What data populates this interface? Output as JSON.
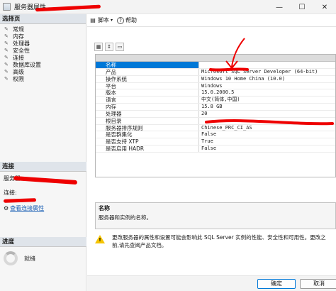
{
  "window": {
    "title": "服务器属性 -",
    "minimize": "—",
    "maximize": "☐",
    "close": "✕"
  },
  "left_panel": {
    "select_page_header": "选择页",
    "pages": [
      "常规",
      "内存",
      "处理器",
      "安全性",
      "连接",
      "数据库设置",
      "高级",
      "权限"
    ],
    "connection_header": "连接",
    "server_label": "服务器:",
    "connection_label": "连接:",
    "view_connection_link": "查看连接属性",
    "progress_header": "进度",
    "progress_status": "就绪"
  },
  "toolbar": {
    "script_label": "脚本",
    "help_label": "帮助"
  },
  "properties": {
    "rows": [
      {
        "name": "名称",
        "value": ""
      },
      {
        "name": "产品",
        "value": "Microsoft SQL Server Developer (64-bit)"
      },
      {
        "name": "操作系统",
        "value": "Windows 10 Home China (10.0)"
      },
      {
        "name": "平台",
        "value": "Windows"
      },
      {
        "name": "版本",
        "value": "15.0.2000.5"
      },
      {
        "name": "语言",
        "value": "中文(简体,中国)"
      },
      {
        "name": "内存",
        "value": "15.8 GB"
      },
      {
        "name": "处理器",
        "value": "20"
      },
      {
        "name": "根目录",
        "value": ""
      },
      {
        "name": "服务器排序规则",
        "value": "Chinese_PRC_CI_AS"
      },
      {
        "name": "是否群集化",
        "value": "False"
      },
      {
        "name": "是否支持 XTP",
        "value": "True"
      },
      {
        "name": "是否启用 HADR",
        "value": "False"
      }
    ]
  },
  "description": {
    "title": "名称",
    "text": "服务器和实例的名称。"
  },
  "warning": {
    "text": "更改服务器的属性和设置可能会影响此 SQL Server 实例的性能、安全性和可用性。更改之前,请先查阅产品文档。"
  },
  "buttons": {
    "ok": "确定",
    "cancel": "取消"
  },
  "colors": {
    "selection": "#0078d7",
    "warning_icon": "#f5c400",
    "redaction": "#e00000"
  }
}
